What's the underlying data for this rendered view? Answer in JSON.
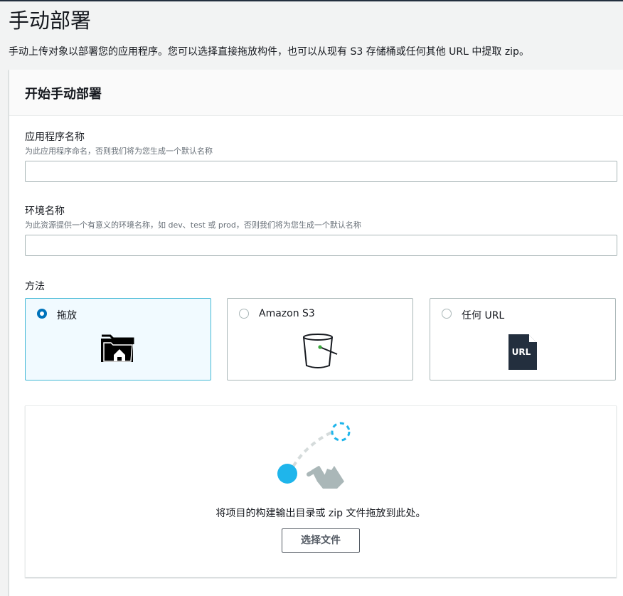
{
  "page": {
    "title": "手动部署",
    "description": "手动上传对象以部署您的应用程序。您可以选择直接拖放构件，也可以从现有 S3 存储桶或任何其他 URL 中提取 zip。"
  },
  "form": {
    "header": "开始手动部署",
    "app_name": {
      "label": "应用程序名称",
      "hint": "为此应用程序命名，否则我们将为您生成一个默认名称",
      "value": "",
      "placeholder": ""
    },
    "env_name": {
      "label": "环境名称",
      "hint": "为此资源提供一个有意义的环境名称，如 dev、test 或 prod，否则我们将为您生成一个默认名称",
      "value": "",
      "placeholder": ""
    },
    "method": {
      "label": "方法",
      "options": [
        {
          "label": "拖放",
          "icon": "drag-drop-folder-icon",
          "selected": true
        },
        {
          "label": "Amazon S3",
          "icon": "s3-bucket-icon",
          "selected": false
        },
        {
          "label": "任何 URL",
          "icon": "url-file-icon",
          "selected": false
        }
      ],
      "url_icon_text": "URL"
    }
  },
  "dropzone": {
    "icon": "drag-hand-icon",
    "text": "将项目的构建输出目录或 zip 文件拖放到此处。",
    "button_label": "选择文件"
  },
  "colors": {
    "accent": "#0073bb",
    "selected_bg": "#f1faff",
    "selected_border": "#44b9d6",
    "drop_dot": "#1fb5eb"
  }
}
